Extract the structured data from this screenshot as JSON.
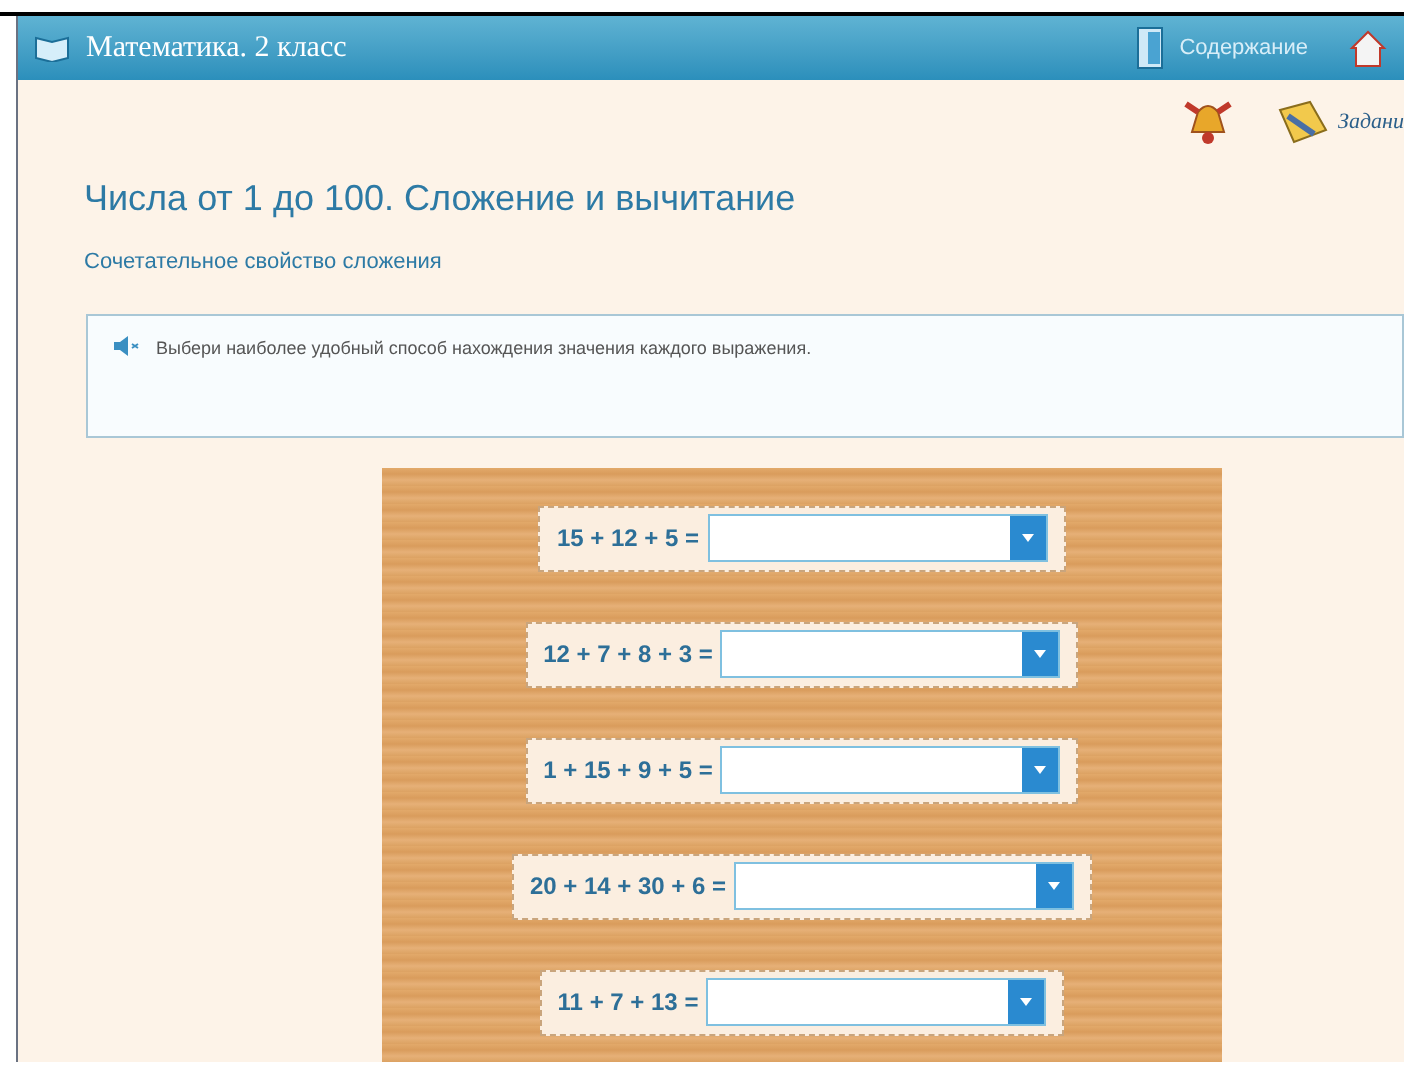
{
  "header": {
    "title": "Математика. 2 класс",
    "contents_link": "Содержание"
  },
  "toolbar": {
    "tasks_link": "Задани"
  },
  "lesson": {
    "title": "Числа от 1 до 100. Сложение и вычитание",
    "subtitle": "Сочетательное свойство сложения"
  },
  "instruction": {
    "text": "Выбери наиболее удобный способ нахождения значения каждого выражения."
  },
  "exercises": [
    {
      "expression": "15 + 12 + 5 ="
    },
    {
      "expression": "12 + 7 + 8 + 3 ="
    },
    {
      "expression": "1 + 15 + 9 + 5 ="
    },
    {
      "expression": "20 + 14 + 30 + 6 ="
    },
    {
      "expression": "11 + 7 + 13 ="
    }
  ]
}
